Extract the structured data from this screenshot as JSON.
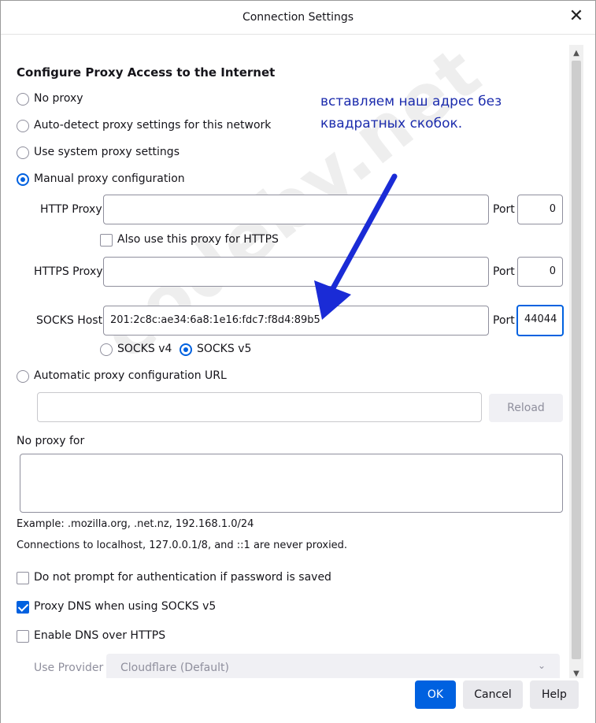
{
  "window": {
    "title": "Connection Settings",
    "close_glyph": "✕"
  },
  "heading": "Configure Proxy Access to the Internet",
  "proxy_modes": {
    "no_proxy": "No proxy",
    "auto_detect": "Auto-detect proxy settings for this network",
    "system": "Use system proxy settings",
    "manual": "Manual proxy configuration",
    "auto_url": "Automatic proxy configuration URL",
    "selected": "manual"
  },
  "http": {
    "label": "HTTP Proxy",
    "value": "",
    "port_label": "Port",
    "port": "0"
  },
  "also_https": {
    "label": "Also use this proxy for HTTPS",
    "checked": false
  },
  "https": {
    "label": "HTTPS Proxy",
    "value": "",
    "port_label": "Port",
    "port": "0"
  },
  "socks": {
    "label": "SOCKS Host",
    "value": "201:2c8c:ae34:6a8:1e16:fdc7:f8d4:89b5",
    "port_label": "Port",
    "port": "44044",
    "v4": "SOCKS v4",
    "v5": "SOCKS v5",
    "version_selected": "v5"
  },
  "auto_url": {
    "value": "",
    "reload": "Reload"
  },
  "no_proxy_for": {
    "label": "No proxy for",
    "value": ""
  },
  "hints": {
    "example": "Example: .mozilla.org, .net.nz, 192.168.1.0/24",
    "localhost": "Connections to localhost, 127.0.0.1/8, and ::1 are never proxied."
  },
  "options": {
    "no_prompt_auth": {
      "label": "Do not prompt for authentication if password is saved",
      "checked": false
    },
    "proxy_dns": {
      "label": "Proxy DNS when using SOCKS v5",
      "checked": true
    },
    "dns_over_https": {
      "label": "Enable DNS over HTTPS",
      "checked": false
    }
  },
  "provider": {
    "label": "Use Provider",
    "value": "Cloudflare (Default)"
  },
  "buttons": {
    "ok": "OK",
    "cancel": "Cancel",
    "help": "Help"
  },
  "annotation": {
    "line1": "вставляем наш адрес без",
    "line2": "квадратных скобок.",
    "color": "#1c2cad"
  },
  "watermark": "codeby.net",
  "colors": {
    "accent": "#0061e0",
    "arrow": "#1a2bd6"
  }
}
